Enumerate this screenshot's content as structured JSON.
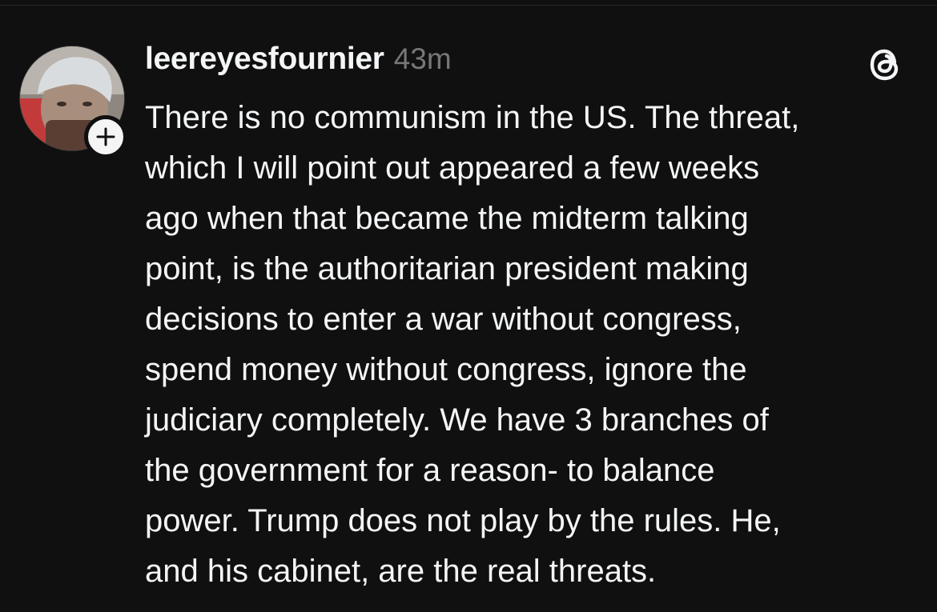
{
  "post": {
    "username": "leereyesfournier",
    "timestamp": "43m",
    "lines": [
      "There is no communism in the US. The threat,",
      "which I will point out appeared a few weeks",
      "ago when that became the midterm talking",
      "point, is the authoritarian president making",
      "decisions to enter a war without congress,",
      "spend money without congress, ignore the",
      "judiciary completely. We have 3 branches of",
      "the government for a reason- to balance",
      "power. Trump does not play by the rules. He,",
      "and his cabinet, are the real threats."
    ],
    "avatar_icon": "user-avatar",
    "follow_icon": "plus-icon",
    "logo_icon": "threads-logo-icon"
  },
  "colors": {
    "background": "#101010",
    "text": "#f3f5f7",
    "muted": "#777777"
  }
}
